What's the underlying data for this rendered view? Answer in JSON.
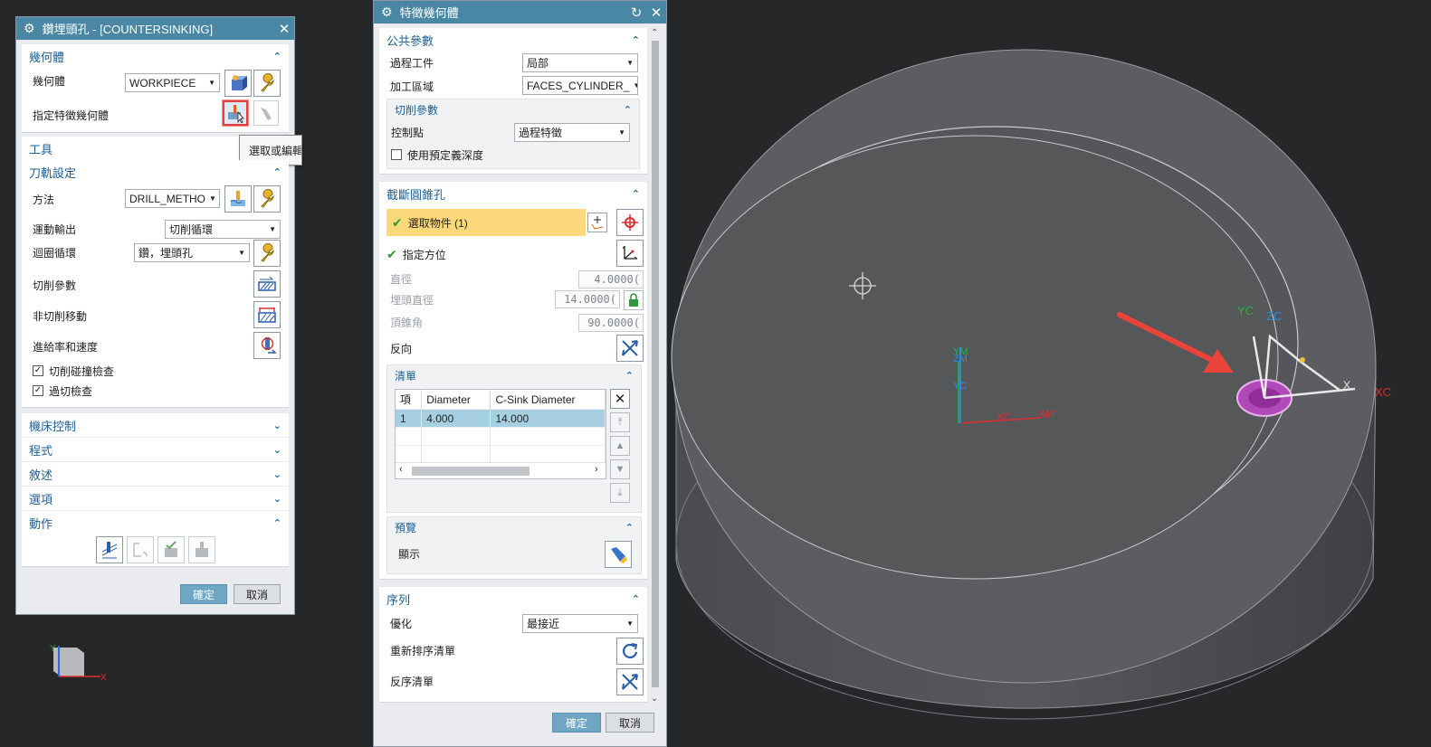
{
  "left_dialog": {
    "title": "鑽埋頭孔 - [COUNTERSINKING]",
    "geometry": {
      "header": "幾何體",
      "geometry_label": "幾何體",
      "geometry_value": "WORKPIECE",
      "feature_label": "指定特徵幾何體",
      "tooltip": "選取或編輯"
    },
    "tool_header": "工具",
    "path": {
      "header": "刀軌設定",
      "method_label": "方法",
      "method_value": "DRILL_METHO",
      "motion_label": "運動輸出",
      "motion_value": "切削循環",
      "cycle_label": "迴圈循環",
      "cycle_value": "鑽，埋頭孔",
      "cut_params_label": "切削參數",
      "noncut_label": "非切削移動",
      "feed_label": "進給率和速度",
      "collision_label": "切削碰撞檢查",
      "overcut_label": "過切檢查"
    },
    "machine_control": "機床控制",
    "program": "程式",
    "description": "敘述",
    "options": "選項",
    "actions": "動作",
    "ok": "確定",
    "cancel": "取消"
  },
  "right_dialog": {
    "title": "特徵幾何體",
    "common": {
      "header": "公共參數",
      "process_label": "過程工件",
      "process_value": "局部",
      "region_label": "加工區域",
      "region_value": "FACES_CYLINDER_",
      "cut_params_header": "切削參數",
      "control_label": "控制點",
      "control_value": "過程特徵",
      "predef_label": "使用預定義深度"
    },
    "countersink": {
      "header": "截斷圓錐孔",
      "select_label": "選取物件 (1)",
      "orient_label": "指定方位",
      "diameter_label": "直徑",
      "diameter_value": "4.0000(",
      "csink_label": "埋頭直徑",
      "csink_value": "14.0000(",
      "angle_label": "頂錐角",
      "angle_value": "90.0000(",
      "reverse_label": "反向"
    },
    "list": {
      "header": "清單",
      "columns": [
        "項",
        "Diameter",
        "C-Sink Diameter"
      ],
      "rows": [
        [
          "1",
          "4.000",
          "14.000"
        ]
      ]
    },
    "preview": {
      "header": "預覽",
      "show_label": "顯示"
    },
    "sequence": {
      "header": "序列",
      "optimize_label": "優化",
      "optimize_value": "最接近",
      "reorder_label": "重新排序清單",
      "reverse_list_label": "反序清單"
    },
    "ok": "確定",
    "cancel": "取消"
  },
  "viewport": {
    "axes_wcs": [
      "YM",
      "ZM",
      "XM",
      "XC",
      "YC"
    ],
    "feature_axes": [
      "YC",
      "ZC",
      "XC",
      "X"
    ],
    "triad": [
      "Y",
      "X"
    ]
  },
  "colors": {
    "titlebar": "#4a87a4",
    "viewport_bg": "#262729",
    "part": "#5a5c60",
    "arrow": "#e8443a",
    "highlight_row": "#a6d0e1",
    "selected_bar": "#fbd97b",
    "accent_text": "#1f5f92"
  }
}
